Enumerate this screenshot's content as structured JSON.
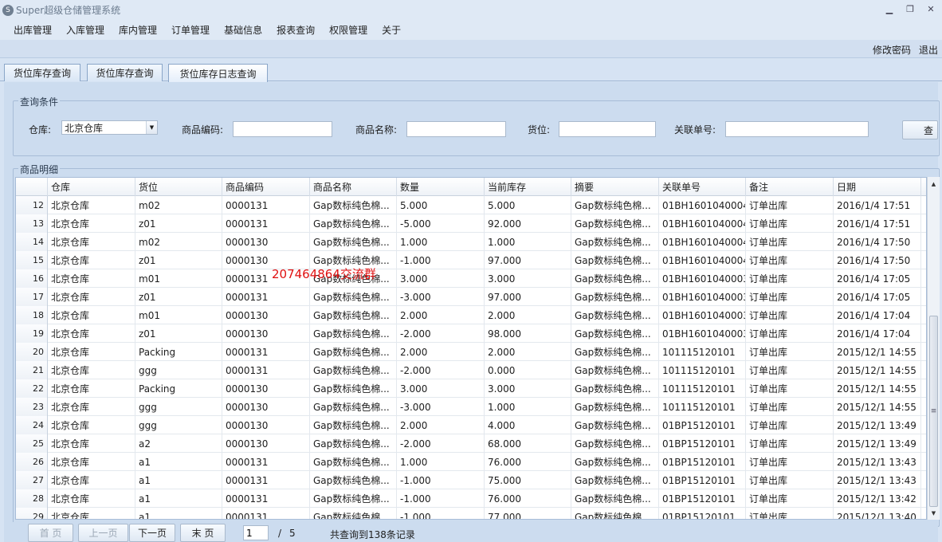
{
  "app": {
    "title": "Super超级仓储管理系统",
    "icon": "S"
  },
  "window": {
    "minimize": "▁",
    "restore": "❐",
    "close": "✕"
  },
  "menu": [
    "出库管理",
    "入库管理",
    "库内管理",
    "订单管理",
    "基础信息",
    "报表查询",
    "权限管理",
    "关于"
  ],
  "account": {
    "change_password": "修改密码",
    "logout": "退出"
  },
  "tabs": [
    "货位库存查询",
    "货位库存查询",
    "货位库存日志查询"
  ],
  "query": {
    "group_title": "查询条件",
    "warehouse_label": "仓库:",
    "warehouse_value": "北京仓库",
    "product_code_label": "商品编码:",
    "product_name_label": "商品名称:",
    "location_label": "货位:",
    "related_no_label": "关联单号:",
    "query_button": "查"
  },
  "details": {
    "group_title": "商品明细"
  },
  "table": {
    "columns": [
      "仓库",
      "货位",
      "商品编码",
      "商品名称",
      "数量",
      "当前库存",
      "摘要",
      "关联单号",
      "备注",
      "日期"
    ],
    "rows": [
      [
        "12",
        "北京仓库",
        "m02",
        "0000131",
        "Gap数标纯色棉...",
        "5.000",
        "5.000",
        "Gap数标纯色棉...",
        "01BH1601040004",
        "订单出库",
        "2016/1/4 17:51"
      ],
      [
        "13",
        "北京仓库",
        "z01",
        "0000131",
        "Gap数标纯色棉...",
        "-5.000",
        "92.000",
        "Gap数标纯色棉...",
        "01BH1601040004",
        "订单出库",
        "2016/1/4 17:51"
      ],
      [
        "14",
        "北京仓库",
        "m02",
        "0000130",
        "Gap数标纯色棉...",
        "1.000",
        "1.000",
        "Gap数标纯色棉...",
        "01BH1601040004",
        "订单出库",
        "2016/1/4 17:50"
      ],
      [
        "15",
        "北京仓库",
        "z01",
        "0000130",
        "Gap数标纯色棉...",
        "-1.000",
        "97.000",
        "Gap数标纯色棉...",
        "01BH1601040004",
        "订单出库",
        "2016/1/4 17:50"
      ],
      [
        "16",
        "北京仓库",
        "m01",
        "0000131",
        "Gap数标纯色棉...",
        "3.000",
        "3.000",
        "Gap数标纯色棉...",
        "01BH1601040003",
        "订单出库",
        "2016/1/4 17:05"
      ],
      [
        "17",
        "北京仓库",
        "z01",
        "0000131",
        "Gap数标纯色棉...",
        "-3.000",
        "97.000",
        "Gap数标纯色棉...",
        "01BH1601040003",
        "订单出库",
        "2016/1/4 17:05"
      ],
      [
        "18",
        "北京仓库",
        "m01",
        "0000130",
        "Gap数标纯色棉...",
        "2.000",
        "2.000",
        "Gap数标纯色棉...",
        "01BH1601040003",
        "订单出库",
        "2016/1/4 17:04"
      ],
      [
        "19",
        "北京仓库",
        "z01",
        "0000130",
        "Gap数标纯色棉...",
        "-2.000",
        "98.000",
        "Gap数标纯色棉...",
        "01BH1601040003",
        "订单出库",
        "2016/1/4 17:04"
      ],
      [
        "20",
        "北京仓库",
        "Packing",
        "0000131",
        "Gap数标纯色棉...",
        "2.000",
        "2.000",
        "Gap数标纯色棉...",
        "101115120101",
        "订单出库",
        "2015/12/1 14:55"
      ],
      [
        "21",
        "北京仓库",
        "ggg",
        "0000131",
        "Gap数标纯色棉...",
        "-2.000",
        "0.000",
        "Gap数标纯色棉...",
        "101115120101",
        "订单出库",
        "2015/12/1 14:55"
      ],
      [
        "22",
        "北京仓库",
        "Packing",
        "0000130",
        "Gap数标纯色棉...",
        "3.000",
        "3.000",
        "Gap数标纯色棉...",
        "101115120101",
        "订单出库",
        "2015/12/1 14:55"
      ],
      [
        "23",
        "北京仓库",
        "ggg",
        "0000130",
        "Gap数标纯色棉...",
        "-3.000",
        "1.000",
        "Gap数标纯色棉...",
        "101115120101",
        "订单出库",
        "2015/12/1 14:55"
      ],
      [
        "24",
        "北京仓库",
        "ggg",
        "0000130",
        "Gap数标纯色棉...",
        "2.000",
        "4.000",
        "Gap数标纯色棉...",
        "01BP15120101",
        "订单出库",
        "2015/12/1 13:49"
      ],
      [
        "25",
        "北京仓库",
        "a2",
        "0000130",
        "Gap数标纯色棉...",
        "-2.000",
        "68.000",
        "Gap数标纯色棉...",
        "01BP15120101",
        "订单出库",
        "2015/12/1 13:49"
      ],
      [
        "26",
        "北京仓库",
        "a1",
        "0000131",
        "Gap数标纯色棉...",
        "1.000",
        "76.000",
        "Gap数标纯色棉...",
        "01BP15120101",
        "订单出库",
        "2015/12/1 13:43"
      ],
      [
        "27",
        "北京仓库",
        "a1",
        "0000131",
        "Gap数标纯色棉...",
        "-1.000",
        "75.000",
        "Gap数标纯色棉...",
        "01BP15120101",
        "订单出库",
        "2015/12/1 13:43"
      ],
      [
        "28",
        "北京仓库",
        "a1",
        "0000131",
        "Gap数标纯色棉...",
        "-1.000",
        "76.000",
        "Gap数标纯色棉...",
        "01BP15120101",
        "订单出库",
        "2015/12/1 13:42"
      ],
      [
        "29",
        "北京仓库",
        "a1",
        "0000131",
        "Gap数标纯色棉...",
        "-1.000",
        "77.000",
        "Gap数标纯色棉...",
        "01BP15120101",
        "订单出库",
        "2015/12/1 13:40"
      ]
    ]
  },
  "watermark": "207464864交流群",
  "pager": {
    "first": "首 页",
    "prev": "上一页",
    "next": "下一页",
    "last": "末 页",
    "current_page": "1",
    "separator": "/",
    "total_pages": "5",
    "summary": "共查询到138条记录"
  },
  "icons": {
    "dropdown": "chevron-down-icon",
    "scroll_up": "arrow-up-icon",
    "scroll_down": "arrow-down-icon"
  }
}
